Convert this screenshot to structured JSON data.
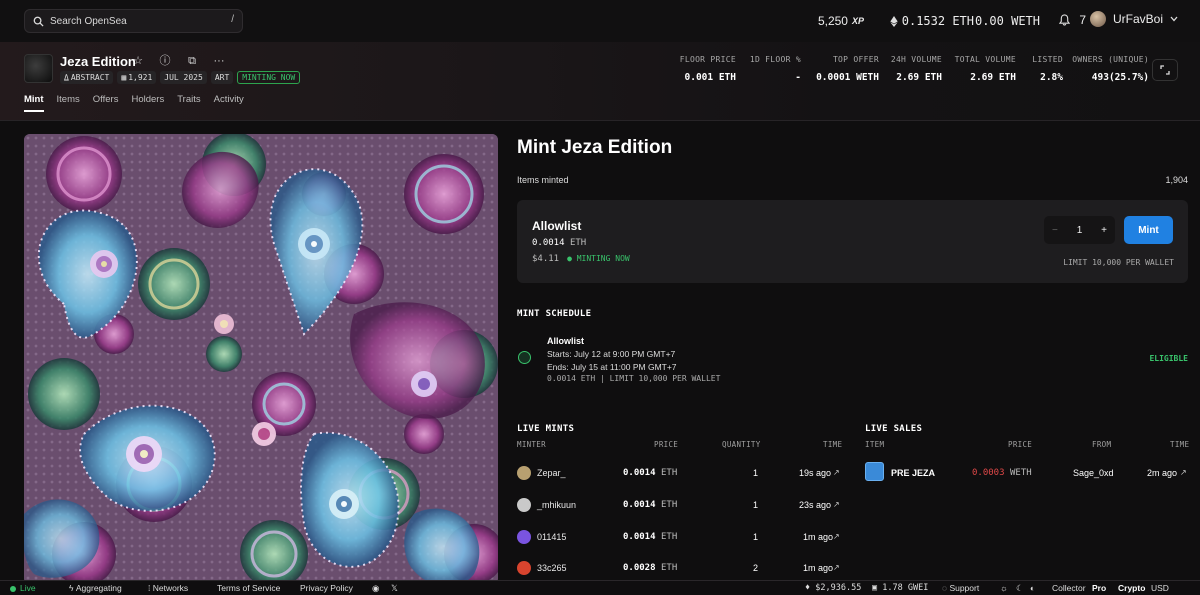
{
  "topbar": {
    "search_placeholder": "Search OpenSea",
    "search_shortcut": "/",
    "xp_value": "5,250",
    "xp_label": "XP",
    "eth_balance": "0.1532 ETH",
    "weth_balance": "0.00 WETH",
    "notifications": "7",
    "username": "UrFavBoi"
  },
  "collection": {
    "name": "Jeza Edition",
    "tags": [
      "ABSTRACT",
      "1,921",
      "JUL 2025",
      "ART",
      "MINTING NOW"
    ],
    "stats": [
      {
        "label": "FLOOR PRICE",
        "value": "0.001 ETH"
      },
      {
        "label": "1D FLOOR %",
        "value": "-"
      },
      {
        "label": "TOP OFFER",
        "value": "0.0001 WETH"
      },
      {
        "label": "24H VOLUME",
        "value": "2.69 ETH"
      },
      {
        "label": "TOTAL VOLUME",
        "value": "2.69 ETH"
      },
      {
        "label": "LISTED",
        "value": "2.8%"
      },
      {
        "label": "OWNERS (UNIQUE)",
        "value": "493(25.7%)"
      }
    ],
    "tabs": [
      "Mint",
      "Items",
      "Offers",
      "Holders",
      "Traits",
      "Activity"
    ]
  },
  "mint": {
    "title": "Mint Jeza Edition",
    "items_minted_label": "Items minted",
    "items_minted_value": "1,904",
    "allowlist": {
      "title": "Allowlist",
      "price": "0.0014",
      "price_unit": "ETH",
      "usd": "$4.11",
      "status": "● MINTING NOW",
      "quantity": "1",
      "minus": "−",
      "plus": "+",
      "mint_button": "Mint",
      "limit": "LIMIT 10,000 PER WALLET"
    },
    "schedule": {
      "title": "MINT SCHEDULE",
      "name": "Allowlist",
      "starts": "Starts: July 12 at 9:00 PM GMT+7",
      "ends": "Ends: July 15 at 11:00 PM GMT+7",
      "meta": "0.0014 ETH | LIMIT 10,000 PER WALLET",
      "status": "ELIGIBLE"
    }
  },
  "live_mints": {
    "title": "LIVE MINTS",
    "headers": [
      "MINTER",
      "PRICE",
      "QUANTITY",
      "TIME"
    ],
    "rows": [
      {
        "minter": "Zepar_",
        "price": "0.0014",
        "unit": "ETH",
        "qty": "1",
        "time": "19s ago",
        "avatar": "#b8a070"
      },
      {
        "minter": "_mhikuun",
        "price": "0.0014",
        "unit": "ETH",
        "qty": "1",
        "time": "23s ago",
        "avatar": "#c9c9c9"
      },
      {
        "minter": "011415",
        "price": "0.0014",
        "unit": "ETH",
        "qty": "1",
        "time": "1m ago",
        "avatar": "#7a54e0"
      },
      {
        "minter": "33c265",
        "price": "0.0028",
        "unit": "ETH",
        "qty": "2",
        "time": "1m ago",
        "avatar": "#d8442e"
      }
    ]
  },
  "live_sales": {
    "title": "LIVE SALES",
    "headers": [
      "ITEM",
      "PRICE",
      "FROM",
      "TIME"
    ],
    "rows": [
      {
        "item": "PRE JEZA",
        "price": "0.0003",
        "unit": "WETH",
        "from": "Sage_0xd",
        "time": "2m ago"
      }
    ]
  },
  "footer": {
    "live": "Live",
    "aggregating": "Aggregating",
    "networks": "Networks",
    "terms": "Terms of Service",
    "privacy": "Privacy Policy",
    "eth_price": "$2,936.55",
    "gas": "1.78 GWEI",
    "support": "Support",
    "collector": "Collector",
    "pro": "Pro",
    "crypto": "Crypto",
    "usd": "USD"
  }
}
